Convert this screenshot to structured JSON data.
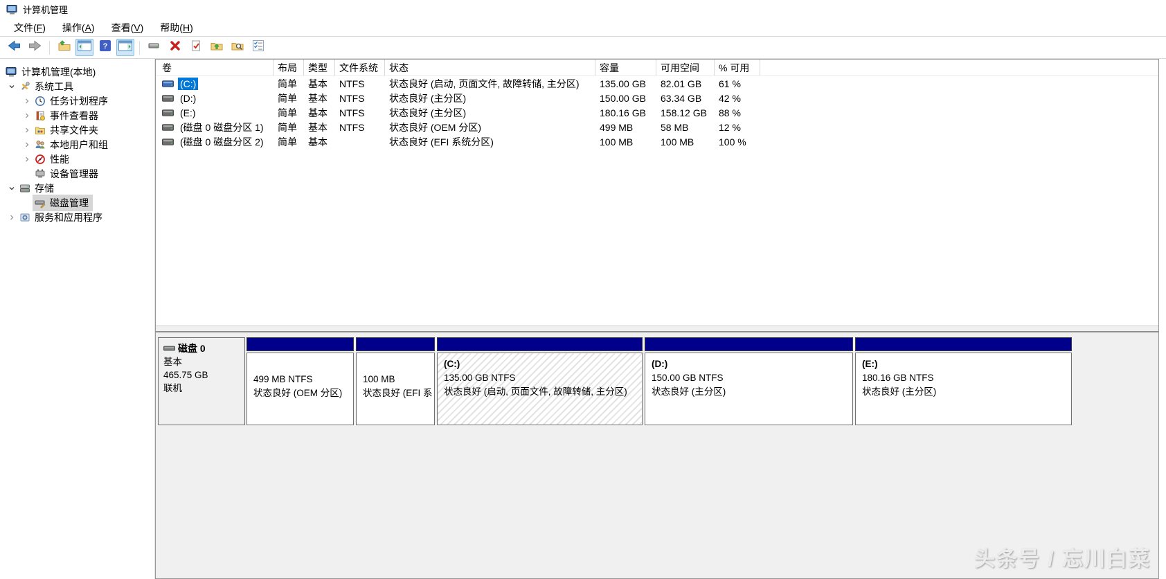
{
  "window": {
    "title": "计算机管理"
  },
  "menu": {
    "items": [
      {
        "pre": "文件(",
        "key": "F",
        "post": ")"
      },
      {
        "pre": "操作(",
        "key": "A",
        "post": ")"
      },
      {
        "pre": "查看(",
        "key": "V",
        "post": ")"
      },
      {
        "pre": "帮助(",
        "key": "H",
        "post": ")"
      }
    ]
  },
  "toolbar": {
    "icons": [
      "back-icon",
      "forward-icon",
      "export-list-icon",
      "console-tree-toggle-icon",
      "help-icon",
      "action-pane-toggle-icon",
      "disk-tool-icon",
      "delete-icon",
      "check-document-icon",
      "folder-up-icon",
      "folder-search-icon",
      "checklist-icon"
    ]
  },
  "sidebar": {
    "items": [
      {
        "label": "计算机管理(本地)",
        "icon": "computer-icon",
        "level": 0,
        "expander": "none",
        "selected": false
      },
      {
        "label": "系统工具",
        "icon": "system-tools-icon",
        "level": 1,
        "expander": "expanded",
        "selected": false
      },
      {
        "label": "任务计划程序",
        "icon": "task-scheduler-icon",
        "level": 2,
        "expander": "collapsed",
        "selected": false
      },
      {
        "label": "事件查看器",
        "icon": "event-viewer-icon",
        "level": 2,
        "expander": "collapsed",
        "selected": false
      },
      {
        "label": "共享文件夹",
        "icon": "shared-folders-icon",
        "level": 2,
        "expander": "collapsed",
        "selected": false
      },
      {
        "label": "本地用户和组",
        "icon": "local-users-icon",
        "level": 2,
        "expander": "collapsed",
        "selected": false
      },
      {
        "label": "性能",
        "icon": "performance-icon",
        "level": 2,
        "expander": "collapsed",
        "selected": false
      },
      {
        "label": "设备管理器",
        "icon": "device-manager-icon",
        "level": 2,
        "expander": "none",
        "selected": false
      },
      {
        "label": "存储",
        "icon": "storage-icon",
        "level": 1,
        "expander": "expanded",
        "selected": false
      },
      {
        "label": "磁盘管理",
        "icon": "disk-management-icon",
        "level": 2,
        "expander": "none",
        "selected": true
      },
      {
        "label": "服务和应用程序",
        "icon": "services-icon",
        "level": 1,
        "expander": "collapsed",
        "selected": false
      }
    ]
  },
  "volumes": {
    "headers": [
      "卷",
      "布局",
      "类型",
      "文件系统",
      "状态",
      "容量",
      "可用空间",
      "% 可用"
    ],
    "rows": [
      {
        "name": "(C:)",
        "layout": "简单",
        "type": "基本",
        "fs": "NTFS",
        "status": "状态良好 (启动, 页面文件, 故障转储, 主分区)",
        "capacity": "135.00 GB",
        "free": "82.01 GB",
        "pct": "61 %",
        "selected": true
      },
      {
        "name": "(D:)",
        "layout": "简单",
        "type": "基本",
        "fs": "NTFS",
        "status": "状态良好 (主分区)",
        "capacity": "150.00 GB",
        "free": "63.34 GB",
        "pct": "42 %",
        "selected": false
      },
      {
        "name": "(E:)",
        "layout": "简单",
        "type": "基本",
        "fs": "NTFS",
        "status": "状态良好 (主分区)",
        "capacity": "180.16 GB",
        "free": "158.12 GB",
        "pct": "88 %",
        "selected": false
      },
      {
        "name": "(磁盘 0 磁盘分区 1)",
        "layout": "简单",
        "type": "基本",
        "fs": "NTFS",
        "status": "状态良好 (OEM 分区)",
        "capacity": "499 MB",
        "free": "58 MB",
        "pct": "12 %",
        "selected": false
      },
      {
        "name": "(磁盘 0 磁盘分区 2)",
        "layout": "简单",
        "type": "基本",
        "fs": "",
        "status": "状态良好 (EFI 系统分区)",
        "capacity": "100 MB",
        "free": "100 MB",
        "pct": "100 %",
        "selected": false
      }
    ]
  },
  "disk": {
    "name": "磁盘 0",
    "type": "基本",
    "size": "465.75 GB",
    "status": "联机"
  },
  "partitions": [
    {
      "title": "",
      "line1": "499 MB NTFS",
      "line2": "状态良好 (OEM 分区)",
      "selected": false
    },
    {
      "title": "",
      "line1": "100 MB",
      "line2": "状态良好 (EFI 系",
      "selected": false
    },
    {
      "title": "(C:)",
      "line1": "135.00 GB NTFS",
      "line2": "状态良好 (启动, 页面文件, 故障转储, 主分区)",
      "selected": true
    },
    {
      "title": "(D:)",
      "line1": "150.00 GB NTFS",
      "line2": "状态良好 (主分区)",
      "selected": false
    },
    {
      "title": "(E:)",
      "line1": "180.16 GB NTFS",
      "line2": "状态良好 (主分区)",
      "selected": false
    }
  ],
  "watermark": {
    "text": "头条号 / 忘川白菜"
  },
  "colors": {
    "accent": "#0078d7",
    "partition_bar": "#00008b",
    "pane_bg": "#f0f0f0",
    "selected_tree_bg": "#d6d6d6"
  }
}
